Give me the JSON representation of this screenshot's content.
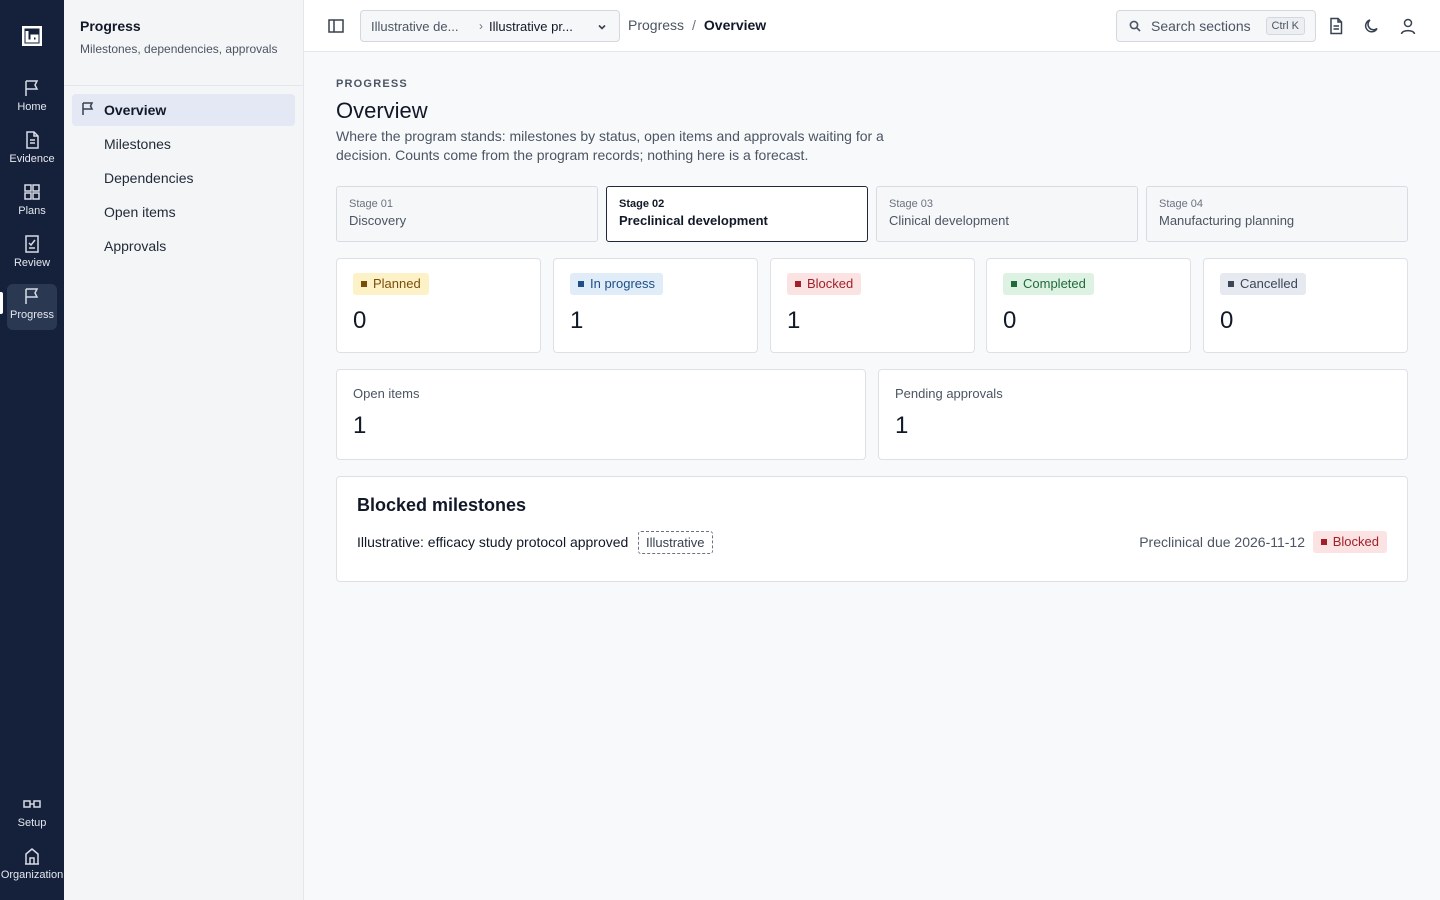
{
  "rail": {
    "items": [
      {
        "label": "Home",
        "icon": "flag-icon"
      },
      {
        "label": "Evidence",
        "icon": "document-icon"
      },
      {
        "label": "Plans",
        "icon": "grid-icon"
      },
      {
        "label": "Review",
        "icon": "checklist-icon"
      },
      {
        "label": "Progress",
        "icon": "flag-icon"
      }
    ],
    "bottom": [
      {
        "label": "Setup",
        "icon": "link-icon"
      },
      {
        "label": "Organization",
        "icon": "building-icon"
      }
    ]
  },
  "sidebar": {
    "title": "Progress",
    "subtitle": "Milestones, dependencies, approvals",
    "items": [
      {
        "label": "Overview"
      },
      {
        "label": "Milestones"
      },
      {
        "label": "Dependencies"
      },
      {
        "label": "Open items"
      },
      {
        "label": "Approvals"
      }
    ]
  },
  "topbar": {
    "program_select": {
      "first": "Illustrative de...",
      "second": "Illustrative pr..."
    },
    "breadcrumb": {
      "parent": "Progress",
      "separator": "/",
      "current": "Overview"
    },
    "search": {
      "placeholder": "Search sections",
      "shortcut": "Ctrl K"
    }
  },
  "page": {
    "eyebrow": "PROGRESS",
    "title": "Overview",
    "description": "Where the program stands: milestones by status, open items and approvals waiting for a decision. Counts come from the program records; nothing here is a forecast."
  },
  "stages": [
    {
      "num": "Stage 01",
      "name": "Discovery"
    },
    {
      "num": "Stage 02",
      "name": "Preclinical development"
    },
    {
      "num": "Stage 03",
      "name": "Clinical development"
    },
    {
      "num": "Stage 04",
      "name": "Manufacturing planning"
    }
  ],
  "status_counts": [
    {
      "label": "Planned",
      "count": "0",
      "bg": "#fdf1c7",
      "fg": "#7a4e0a"
    },
    {
      "label": "In progress",
      "count": "1",
      "bg": "#e0ecf8",
      "fg": "#1e4f86"
    },
    {
      "label": "Blocked",
      "count": "1",
      "bg": "#fbe3e3",
      "fg": "#a1212a"
    },
    {
      "label": "Completed",
      "count": "0",
      "bg": "#def2e3",
      "fg": "#1f6b3a"
    },
    {
      "label": "Cancelled",
      "count": "0",
      "bg": "#e6e9ef",
      "fg": "#3b4657"
    }
  ],
  "metrics": {
    "open_items": {
      "label": "Open items",
      "value": "1"
    },
    "pending_approvals": {
      "label": "Pending approvals",
      "value": "1"
    }
  },
  "blocked_milestones": {
    "title": "Blocked milestones",
    "rows": [
      {
        "name": "Illustrative: efficacy study protocol approved",
        "tag": "Illustrative",
        "stage": "Preclinical",
        "due": "due 2026-11-12",
        "status": "Blocked"
      }
    ]
  }
}
